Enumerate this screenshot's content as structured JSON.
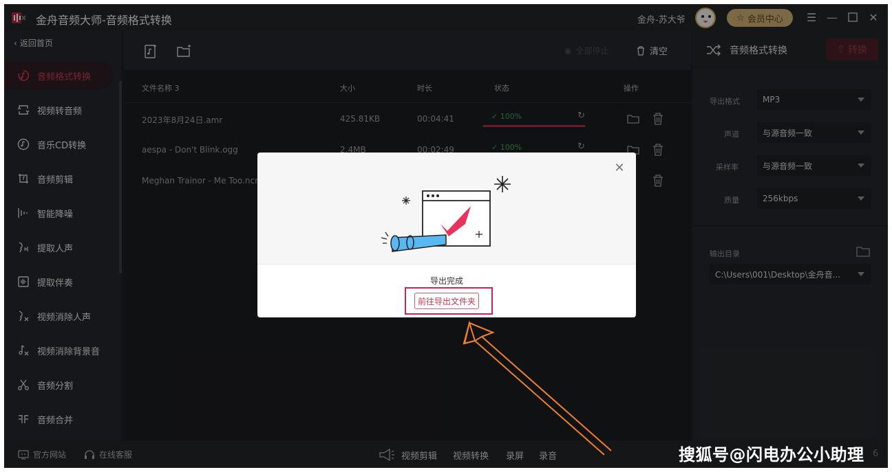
{
  "window": {
    "title": "金舟音频大师-音频格式转换",
    "user_name": "金舟-苏大爷",
    "vip_label": "会员中心"
  },
  "sidebar": {
    "back_label": "返回首页",
    "items": [
      {
        "label": "音频格式转换",
        "icon": "music-convert-icon",
        "active": true
      },
      {
        "label": "视频转音频",
        "icon": "video-to-audio-icon",
        "active": false
      },
      {
        "label": "音乐CD转换",
        "icon": "cd-icon",
        "active": false
      },
      {
        "label": "音频剪辑",
        "icon": "audio-cut-icon",
        "active": false
      },
      {
        "label": "智能降噪",
        "icon": "noise-reduce-icon",
        "active": false
      },
      {
        "label": "提取人声",
        "icon": "voice-extract-icon",
        "active": false
      },
      {
        "label": "提取伴奏",
        "icon": "accompaniment-icon",
        "active": false
      },
      {
        "label": "视频消除人声",
        "icon": "video-remove-voice-icon",
        "active": false
      },
      {
        "label": "视频消除背景音",
        "icon": "video-remove-bg-icon",
        "active": false
      },
      {
        "label": "音频分割",
        "icon": "scissors-icon",
        "active": false
      },
      {
        "label": "音频合并",
        "icon": "merge-icon",
        "active": false
      }
    ]
  },
  "toolbar": {
    "stop_all_label": "全部停止",
    "clear_label": "清空"
  },
  "table": {
    "headers": [
      "文件名称 3",
      "大小",
      "时长",
      "状态",
      "操作"
    ],
    "rows": [
      {
        "name": "2023年8月24日.amr",
        "size": "425.81KB",
        "duration": "00:04:41",
        "status": "100%"
      },
      {
        "name": "aespa - Don't Blink.ogg",
        "size": "2.4MB",
        "duration": "00:02:49",
        "status": "100%"
      },
      {
        "name": "Meghan Trainor - Me Too.ncm",
        "size": "",
        "duration": "",
        "status": ""
      }
    ]
  },
  "right_panel": {
    "title": "音频格式转换",
    "convert_label": "转换",
    "settings": [
      {
        "label": "导出格式",
        "value": "MP3"
      },
      {
        "label": "声道",
        "value": "与源音频一致"
      },
      {
        "label": "采样率",
        "value": "与源音频一致"
      },
      {
        "label": "质量",
        "value": "256kbps"
      }
    ],
    "output_dir_label": "输出目录",
    "output_dir_value": "C:\\Users\\001\\Desktop\\金舟音..."
  },
  "footer": {
    "links": [
      "官方网站",
      "在线客服"
    ],
    "tools": [
      "视频剪辑",
      "视频转换",
      "录屏",
      "录音"
    ],
    "version_tail": "6"
  },
  "modal": {
    "message": "导出完成",
    "open_folder_label": "前往导出文件夹"
  },
  "watermark": "搜狐号@闪电办公小助理",
  "colors": {
    "accent": "#c23a50",
    "success": "#3aa25a",
    "progress": "#b52b42",
    "annotation": "#d02058",
    "arrow": "#f08030"
  }
}
